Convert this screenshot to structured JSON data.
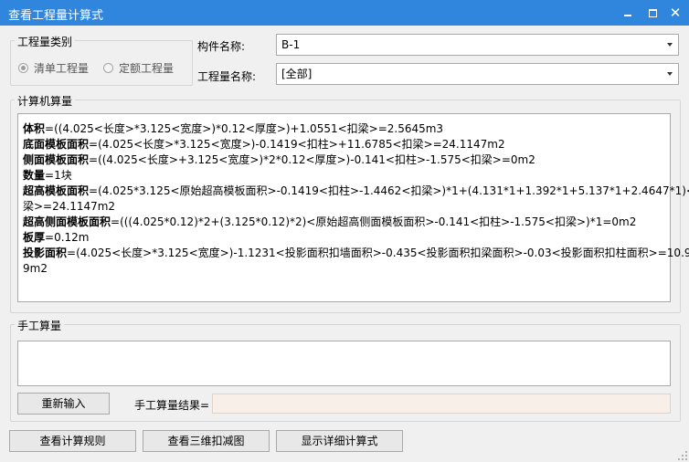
{
  "window": {
    "title": "查看工程量计算式",
    "close_glyph": "✕"
  },
  "quantity_category": {
    "label": "工程量类别",
    "options": [
      {
        "label": "清单工程量",
        "checked": true
      },
      {
        "label": "定额工程量",
        "checked": false
      }
    ]
  },
  "component": {
    "label": "构件名称:",
    "value": "B-1"
  },
  "quantity_name": {
    "label": "工程量名称:",
    "value": "[全部]"
  },
  "computed": {
    "label": "计算机算量",
    "lines": [
      {
        "name": "体积",
        "expr": "=((4.025<长度>*3.125<宽度>)*0.12<厚度>)+1.0551<扣梁>=2.5645m3"
      },
      {
        "name": "底面模板面积",
        "expr": "=(4.025<长度>*3.125<宽度>)-0.1419<扣柱>+11.6785<扣梁>=24.1147m2"
      },
      {
        "name": "侧面模板面积",
        "expr": "=((4.025<长度>+3.125<宽度>)*2*0.12<厚度>)-0.141<扣柱>-1.575<扣梁>=0m2"
      },
      {
        "name": "数量",
        "expr": "=1块"
      },
      {
        "name": "超高模板面积",
        "expr": "=(4.025*3.125<原始超高模板面积>-0.1419<扣柱>-1.4462<扣梁>)*1+(4.131*1+1.392*1+5.137*1+2.4647*1)<加"
      },
      {
        "name": "",
        "expr": "梁>=24.1147m2"
      },
      {
        "name": "超高侧面模板面积",
        "expr": "=(((4.025*0.12)*2+(3.125*0.12)*2)<原始超高侧面模板面积>-0.141<扣柱>-1.575<扣梁>)*1=0m2"
      },
      {
        "name": "板厚",
        "expr": "=0.12m"
      },
      {
        "name": "投影面积",
        "expr": "=(4.025<长度>*3.125<宽度>)-1.1231<投影面积扣墙面积>-0.435<投影面积扣梁面积>-0.03<投影面积扣柱面积>=10.9"
      },
      {
        "name": "",
        "expr": "9m2"
      }
    ]
  },
  "manual": {
    "label": "手工算量",
    "text": "",
    "reenter_label": "重新输入",
    "result_label": "手工算量结果=",
    "result_value": ""
  },
  "buttons": {
    "rules": "查看计算规则",
    "view3d": "查看三维扣减图",
    "detail": "显示详细计算式"
  }
}
